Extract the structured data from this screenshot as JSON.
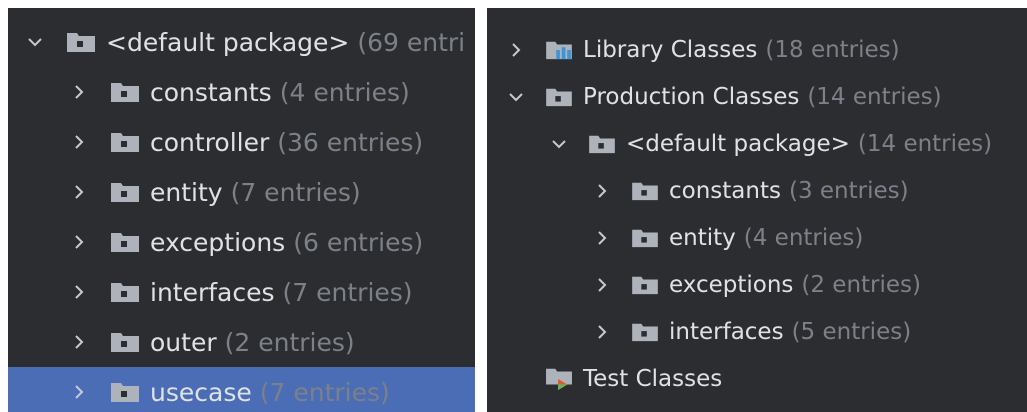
{
  "left": {
    "items": [
      {
        "name": "<default package>",
        "count": "(69 entri",
        "expanded": true,
        "level": 0,
        "icon": "package-folder-icon"
      },
      {
        "name": "constants",
        "count": "(4 entries)",
        "expanded": false,
        "level": 1,
        "icon": "package-folder-icon"
      },
      {
        "name": "controller",
        "count": "(36 entries)",
        "expanded": false,
        "level": 1,
        "icon": "package-folder-icon"
      },
      {
        "name": "entity",
        "count": "(7 entries)",
        "expanded": false,
        "level": 1,
        "icon": "package-folder-icon"
      },
      {
        "name": "exceptions",
        "count": "(6 entries)",
        "expanded": false,
        "level": 1,
        "icon": "package-folder-icon"
      },
      {
        "name": "interfaces",
        "count": "(7 entries)",
        "expanded": false,
        "level": 1,
        "icon": "package-folder-icon"
      },
      {
        "name": "outer",
        "count": "(2 entries)",
        "expanded": false,
        "level": 1,
        "icon": "package-folder-icon"
      },
      {
        "name": "usecase",
        "count": "(7 entries)",
        "expanded": false,
        "level": 1,
        "icon": "package-folder-icon",
        "selected": true
      }
    ]
  },
  "right": {
    "items": [
      {
        "name": "Library Classes",
        "count": "(18 entries)",
        "expanded": false,
        "level": 0,
        "icon": "library-classes-icon"
      },
      {
        "name": "Production Classes",
        "count": "(14 entries)",
        "expanded": true,
        "level": 0,
        "icon": "package-folder-icon"
      },
      {
        "name": "<default package>",
        "count": "(14 entries)",
        "expanded": true,
        "level": 1,
        "icon": "package-folder-icon"
      },
      {
        "name": "constants",
        "count": "(3 entries)",
        "expanded": false,
        "level": 2,
        "icon": "package-folder-icon"
      },
      {
        "name": "entity",
        "count": "(4 entries)",
        "expanded": false,
        "level": 2,
        "icon": "package-folder-icon"
      },
      {
        "name": "exceptions",
        "count": "(2 entries)",
        "expanded": false,
        "level": 2,
        "icon": "package-folder-icon"
      },
      {
        "name": "interfaces",
        "count": "(5 entries)",
        "expanded": false,
        "level": 2,
        "icon": "package-folder-icon"
      },
      {
        "name": "Test Classes",
        "count": "",
        "expanded": false,
        "level": 0,
        "icon": "test-classes-icon",
        "no_chevron": true
      }
    ]
  },
  "colors": {
    "background": "#2b2d30",
    "selection": "#4a6db6",
    "text": "#dfe1e5",
    "count_text": "#7c8088",
    "folder": "#aeb3bb",
    "folder_badge": "#2b2d30",
    "library_bars": "#3d95d8",
    "test_accent": "#e0592d",
    "test_accent2": "#5fb85f"
  }
}
